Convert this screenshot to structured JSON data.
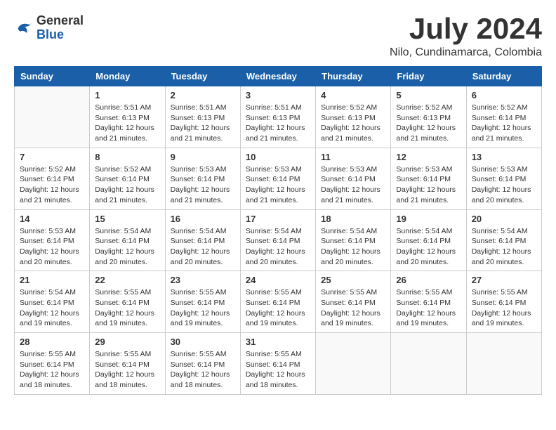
{
  "logo": {
    "general": "General",
    "blue": "Blue"
  },
  "title": {
    "month_year": "July 2024",
    "location": "Nilo, Cundinamarca, Colombia"
  },
  "days_of_week": [
    "Sunday",
    "Monday",
    "Tuesday",
    "Wednesday",
    "Thursday",
    "Friday",
    "Saturday"
  ],
  "weeks": [
    {
      "days": [
        {
          "number": "",
          "info": ""
        },
        {
          "number": "1",
          "info": "Sunrise: 5:51 AM\nSunset: 6:13 PM\nDaylight: 12 hours\nand 21 minutes."
        },
        {
          "number": "2",
          "info": "Sunrise: 5:51 AM\nSunset: 6:13 PM\nDaylight: 12 hours\nand 21 minutes."
        },
        {
          "number": "3",
          "info": "Sunrise: 5:51 AM\nSunset: 6:13 PM\nDaylight: 12 hours\nand 21 minutes."
        },
        {
          "number": "4",
          "info": "Sunrise: 5:52 AM\nSunset: 6:13 PM\nDaylight: 12 hours\nand 21 minutes."
        },
        {
          "number": "5",
          "info": "Sunrise: 5:52 AM\nSunset: 6:13 PM\nDaylight: 12 hours\nand 21 minutes."
        },
        {
          "number": "6",
          "info": "Sunrise: 5:52 AM\nSunset: 6:14 PM\nDaylight: 12 hours\nand 21 minutes."
        }
      ]
    },
    {
      "days": [
        {
          "number": "7",
          "info": "Sunrise: 5:52 AM\nSunset: 6:14 PM\nDaylight: 12 hours\nand 21 minutes."
        },
        {
          "number": "8",
          "info": "Sunrise: 5:52 AM\nSunset: 6:14 PM\nDaylight: 12 hours\nand 21 minutes."
        },
        {
          "number": "9",
          "info": "Sunrise: 5:53 AM\nSunset: 6:14 PM\nDaylight: 12 hours\nand 21 minutes."
        },
        {
          "number": "10",
          "info": "Sunrise: 5:53 AM\nSunset: 6:14 PM\nDaylight: 12 hours\nand 21 minutes."
        },
        {
          "number": "11",
          "info": "Sunrise: 5:53 AM\nSunset: 6:14 PM\nDaylight: 12 hours\nand 21 minutes."
        },
        {
          "number": "12",
          "info": "Sunrise: 5:53 AM\nSunset: 6:14 PM\nDaylight: 12 hours\nand 21 minutes."
        },
        {
          "number": "13",
          "info": "Sunrise: 5:53 AM\nSunset: 6:14 PM\nDaylight: 12 hours\nand 20 minutes."
        }
      ]
    },
    {
      "days": [
        {
          "number": "14",
          "info": "Sunrise: 5:53 AM\nSunset: 6:14 PM\nDaylight: 12 hours\nand 20 minutes."
        },
        {
          "number": "15",
          "info": "Sunrise: 5:54 AM\nSunset: 6:14 PM\nDaylight: 12 hours\nand 20 minutes."
        },
        {
          "number": "16",
          "info": "Sunrise: 5:54 AM\nSunset: 6:14 PM\nDaylight: 12 hours\nand 20 minutes."
        },
        {
          "number": "17",
          "info": "Sunrise: 5:54 AM\nSunset: 6:14 PM\nDaylight: 12 hours\nand 20 minutes."
        },
        {
          "number": "18",
          "info": "Sunrise: 5:54 AM\nSunset: 6:14 PM\nDaylight: 12 hours\nand 20 minutes."
        },
        {
          "number": "19",
          "info": "Sunrise: 5:54 AM\nSunset: 6:14 PM\nDaylight: 12 hours\nand 20 minutes."
        },
        {
          "number": "20",
          "info": "Sunrise: 5:54 AM\nSunset: 6:14 PM\nDaylight: 12 hours\nand 20 minutes."
        }
      ]
    },
    {
      "days": [
        {
          "number": "21",
          "info": "Sunrise: 5:54 AM\nSunset: 6:14 PM\nDaylight: 12 hours\nand 19 minutes."
        },
        {
          "number": "22",
          "info": "Sunrise: 5:55 AM\nSunset: 6:14 PM\nDaylight: 12 hours\nand 19 minutes."
        },
        {
          "number": "23",
          "info": "Sunrise: 5:55 AM\nSunset: 6:14 PM\nDaylight: 12 hours\nand 19 minutes."
        },
        {
          "number": "24",
          "info": "Sunrise: 5:55 AM\nSunset: 6:14 PM\nDaylight: 12 hours\nand 19 minutes."
        },
        {
          "number": "25",
          "info": "Sunrise: 5:55 AM\nSunset: 6:14 PM\nDaylight: 12 hours\nand 19 minutes."
        },
        {
          "number": "26",
          "info": "Sunrise: 5:55 AM\nSunset: 6:14 PM\nDaylight: 12 hours\nand 19 minutes."
        },
        {
          "number": "27",
          "info": "Sunrise: 5:55 AM\nSunset: 6:14 PM\nDaylight: 12 hours\nand 19 minutes."
        }
      ]
    },
    {
      "days": [
        {
          "number": "28",
          "info": "Sunrise: 5:55 AM\nSunset: 6:14 PM\nDaylight: 12 hours\nand 18 minutes."
        },
        {
          "number": "29",
          "info": "Sunrise: 5:55 AM\nSunset: 6:14 PM\nDaylight: 12 hours\nand 18 minutes."
        },
        {
          "number": "30",
          "info": "Sunrise: 5:55 AM\nSunset: 6:14 PM\nDaylight: 12 hours\nand 18 minutes."
        },
        {
          "number": "31",
          "info": "Sunrise: 5:55 AM\nSunset: 6:14 PM\nDaylight: 12 hours\nand 18 minutes."
        },
        {
          "number": "",
          "info": ""
        },
        {
          "number": "",
          "info": ""
        },
        {
          "number": "",
          "info": ""
        }
      ]
    }
  ]
}
